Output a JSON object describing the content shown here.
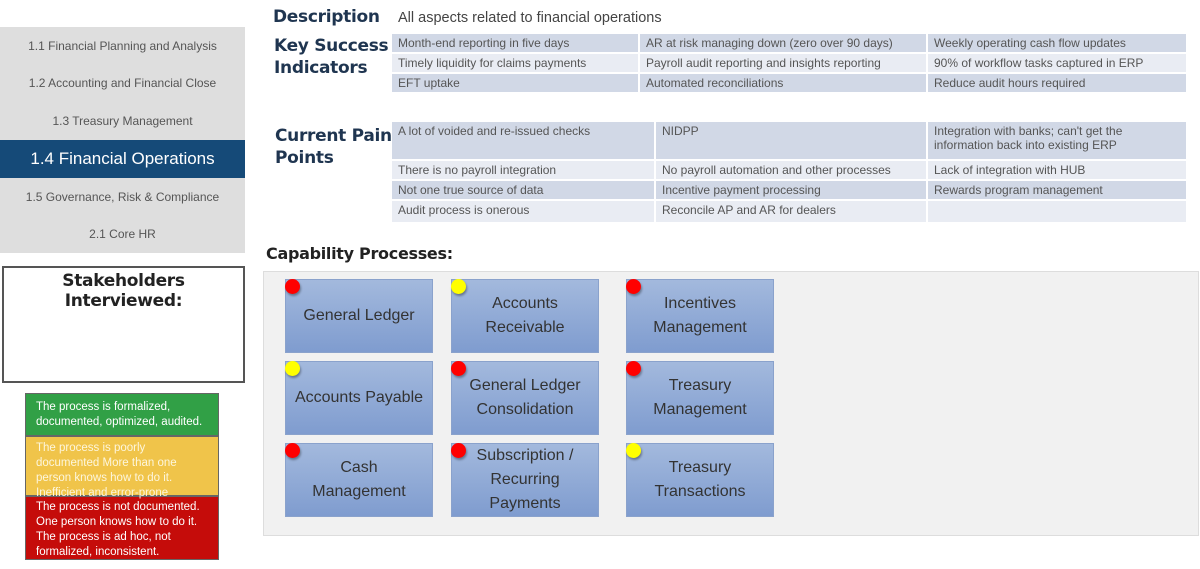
{
  "sidebar": {
    "items": [
      {
        "label": "1.1 Financial Planning and Analysis",
        "active": false
      },
      {
        "label": "1.2 Accounting and Financial Close",
        "active": false
      },
      {
        "label": "1.3 Treasury Management",
        "active": false
      },
      {
        "label": "1.4 Financial Operations",
        "active": true
      },
      {
        "label": "1.5 Governance, Risk & Compliance",
        "active": false
      },
      {
        "label": "2.1 Core HR",
        "active": false
      }
    ]
  },
  "stakeholders": {
    "title": "Stakeholders Interviewed:"
  },
  "legend": {
    "green": {
      "text": "The process is formalized, documented, optimized, audited.",
      "color": "#31a046"
    },
    "yellow": {
      "text": "The process is poorly documented More than one person knows how to do it. Inefficient and error-prone",
      "color": "#f0c44a"
    },
    "red": {
      "text": "The process is not documented. One person knows how to do it. The process is ad hoc, not formalized, inconsistent.",
      "color": "#c50c0a"
    }
  },
  "description": {
    "label": "Description",
    "text": "All aspects related to financial operations"
  },
  "ksi": {
    "label_line1": "Key Success",
    "label_line2": "Indicators",
    "rows": [
      [
        "Month-end reporting in five days",
        "AR at risk managing down (zero over 90 days)",
        "Weekly operating cash flow updates"
      ],
      [
        "Timely liquidity for claims payments",
        "Payroll audit reporting and insights reporting",
        "90% of workflow tasks captured in ERP"
      ],
      [
        "EFT uptake",
        "Automated reconciliations",
        "Reduce audit hours required"
      ]
    ]
  },
  "pain": {
    "label_line1": "Current Pain",
    "label_line2": "Points",
    "rows": [
      [
        "A lot of voided and re-issued checks",
        "NIDPP",
        "Integration with banks; can't get the information back into existing ERP"
      ],
      [
        "There is no payroll integration",
        "No payroll automation and other processes",
        "Lack of integration with HUB"
      ],
      [
        "Not one true source of data",
        "Incentive payment processing",
        "Rewards program management"
      ],
      [
        "Audit process is onerous",
        "Reconcile AP and AR for dealers",
        ""
      ]
    ]
  },
  "capabilities": {
    "title": "Capability Processes:",
    "processes": [
      {
        "label": "General Ledger",
        "status": "red"
      },
      {
        "label": "Accounts Receivable",
        "status": "yellow"
      },
      {
        "label": "Incentives Management",
        "status": "red"
      },
      {
        "label": "Accounts Payable",
        "status": "yellow"
      },
      {
        "label": "General Ledger Consolidation",
        "status": "red"
      },
      {
        "label": "Treasury Management",
        "status": "red"
      },
      {
        "label": "Cash Management",
        "status": "red"
      },
      {
        "label": "Subscription / Recurring Payments",
        "status": "red"
      },
      {
        "label": "Treasury Transactions",
        "status": "yellow"
      }
    ]
  }
}
